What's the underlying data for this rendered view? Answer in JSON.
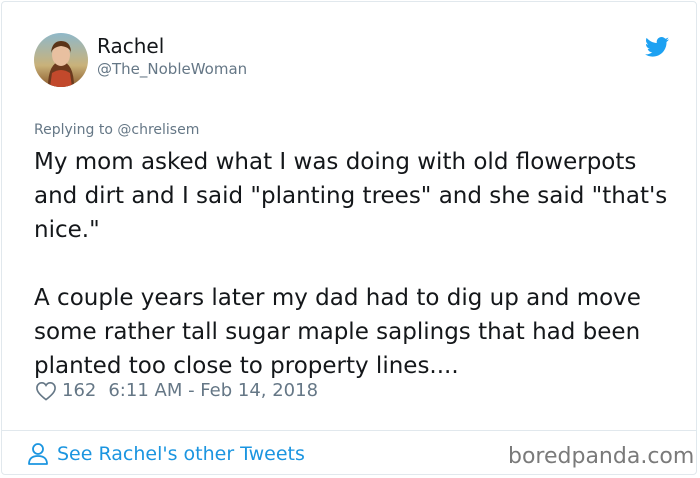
{
  "tweet": {
    "author_name": "Rachel",
    "author_handle": "@The_NobleWoman",
    "replying_to": "Replying to @chrelisem",
    "paragraphs": [
      "My mom asked what I was doing with old flowerpots and dirt and I said \"planting trees\" and she said \"that's nice.\"",
      "A couple years later my dad had to dig up and move some rather tall sugar maple saplings that had been planted too close to property lines...."
    ],
    "likes": "162",
    "timestamp": "6:11 AM - Feb 14, 2018"
  },
  "footer": {
    "see_more_link": "See Rachel's other Tweets",
    "watermark": "boredpanda.com"
  },
  "icons": {
    "bird": "twitter-bird-icon",
    "heart": "heart-icon",
    "user": "user-icon"
  },
  "colors": {
    "link": "#1b95e0",
    "muted": "#657786",
    "border": "#e1e8ed",
    "twitter_blue": "#1da1f2"
  }
}
